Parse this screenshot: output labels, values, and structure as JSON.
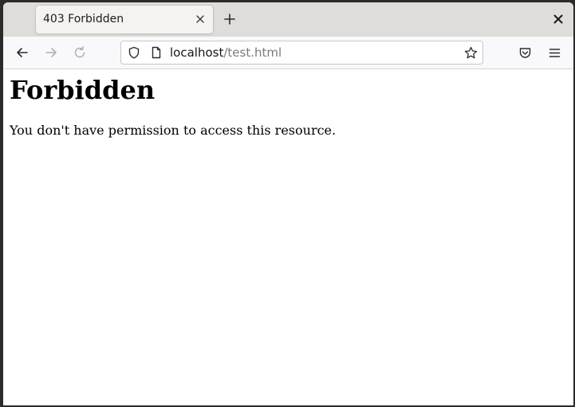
{
  "tab": {
    "title": "403 Forbidden",
    "close_icon": "close-icon"
  },
  "toolbar": {
    "new_tab_icon": "plus-icon",
    "window_close_icon": "close-icon",
    "back_icon": "arrow-left-icon",
    "forward_icon": "arrow-right-icon",
    "reload_icon": "reload-icon",
    "pocket_icon": "pocket-icon",
    "menu_icon": "hamburger-menu-icon"
  },
  "urlbar": {
    "host": "localhost",
    "path": "/test.html",
    "shield_icon": "shield-icon",
    "page_icon": "page-icon",
    "bookmark_icon": "star-icon"
  },
  "page": {
    "heading": "Forbidden",
    "message": "You don't have permission to access this resource."
  },
  "colors": {
    "tabstrip_bg": "#dfdcd9",
    "active_tab_bg": "#f4f3f2",
    "navbar_bg": "#f9f9fb",
    "url_path_color": "#7a7a80",
    "disabled_icon_color": "#b0b0b4"
  }
}
